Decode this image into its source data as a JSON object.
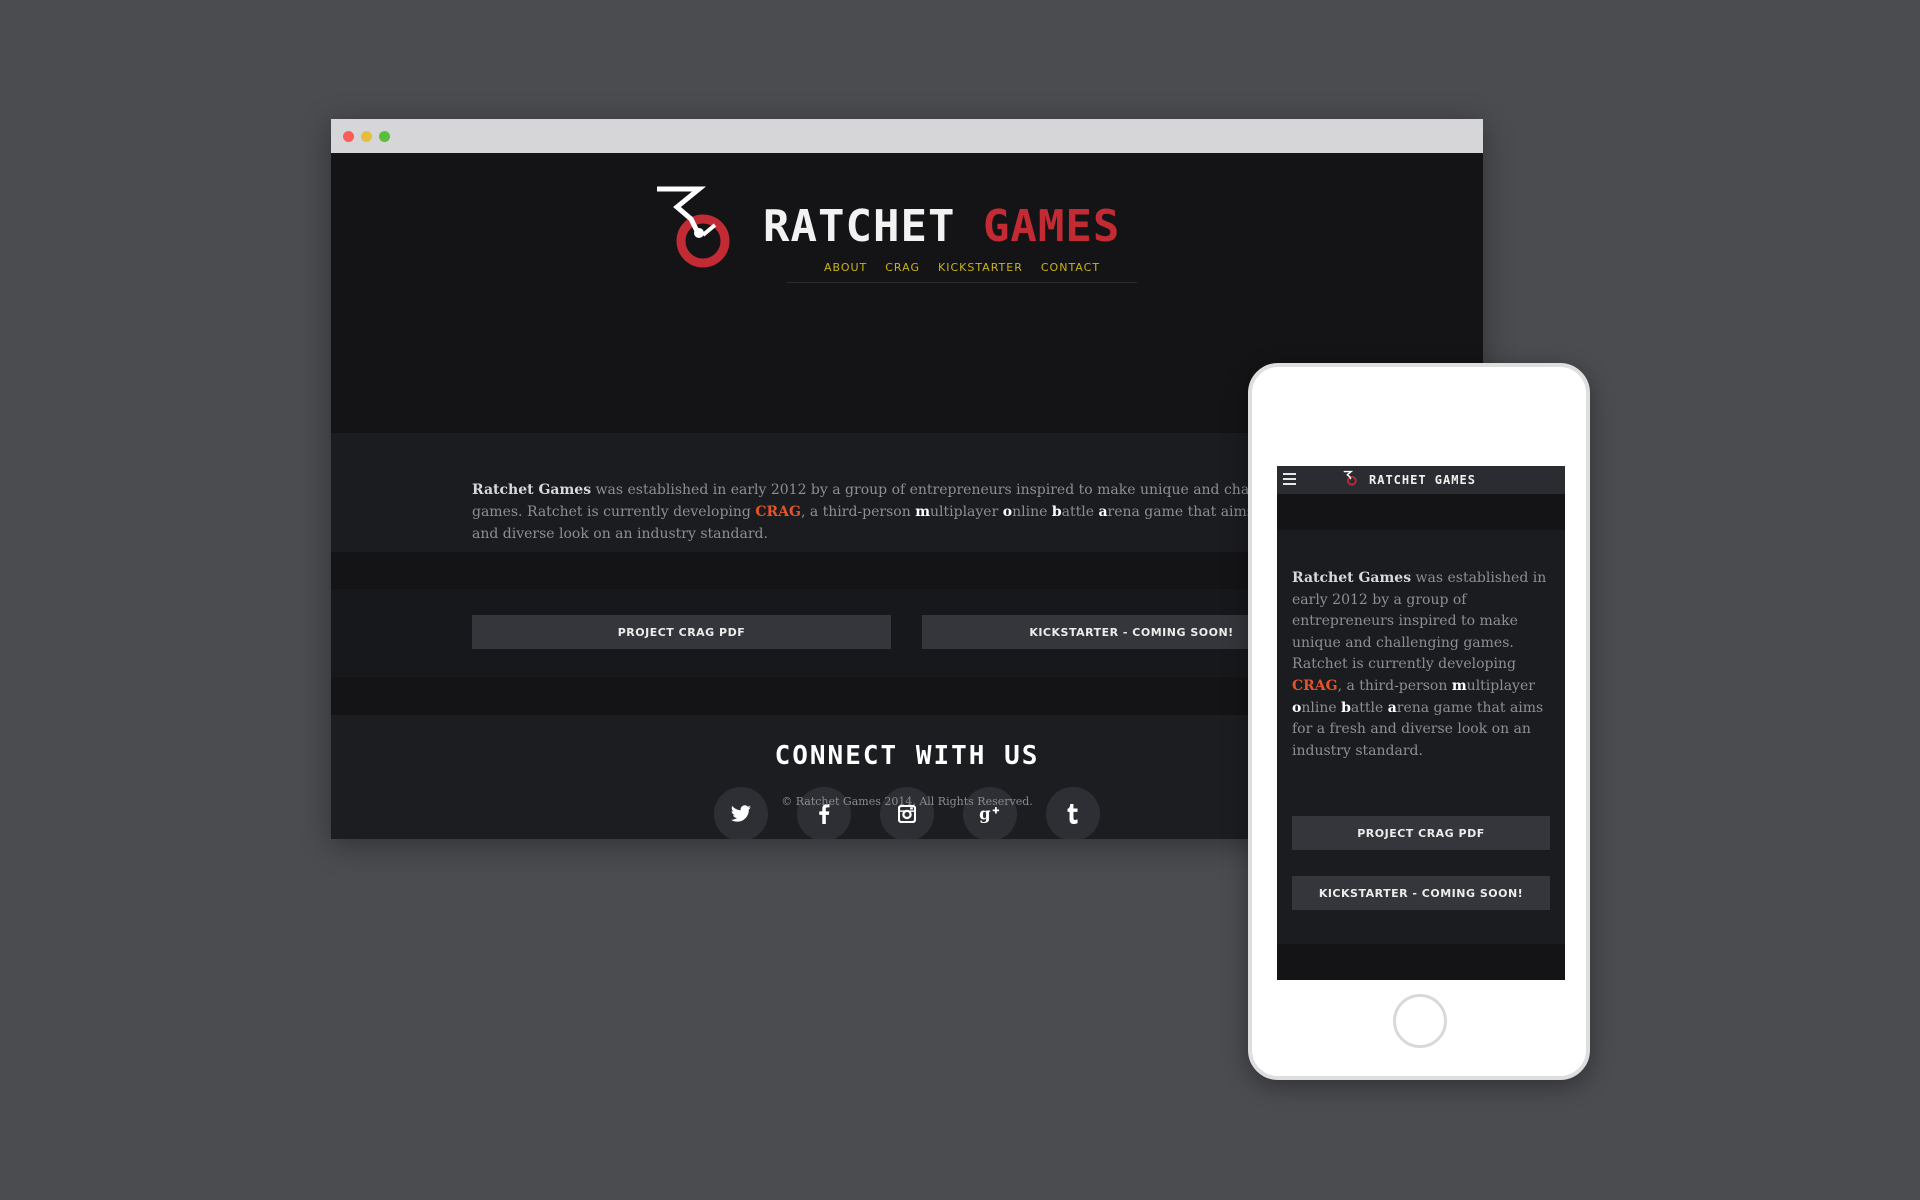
{
  "site": {
    "brand_white": "RATCHET",
    "brand_red": "GAMES",
    "nav": [
      "ABOUT",
      "CRAG",
      "KICKSTARTER",
      "CONTACT"
    ],
    "about": {
      "company": "Ratchet Games",
      "text1": " was established in early 2012 by a group of entrepreneurs inspired to make unique and challenging games. Ratchet is currently developing ",
      "crag": "CRAG",
      "text2": ", a third-person ",
      "m": "m",
      "ultiplayer": "ultiplayer ",
      "o": "o",
      "nline": "nline ",
      "b": "b",
      "attle": "attle ",
      "a": "a",
      "rest": "rena game that aims for a fresh and diverse look on an industry standard."
    },
    "buttons": {
      "pdf": "PROJECT CRAG PDF",
      "kickstarter": "KICKSTARTER - COMING SOON!"
    },
    "connect_title": "CONNECT WITH US",
    "social_icons": [
      "twitter-icon",
      "facebook-icon",
      "instagram-icon",
      "google-plus-icon",
      "tumblr-icon"
    ],
    "footer": "© Ratchet Games 2014. All Rights Reserved."
  },
  "mobile": {
    "brand": "RATCHET GAMES"
  },
  "colors": {
    "background": "#4b4c50",
    "brand_red": "#c22a34",
    "nav_yellow": "#c8b418",
    "crag_orange": "#e5532a"
  }
}
